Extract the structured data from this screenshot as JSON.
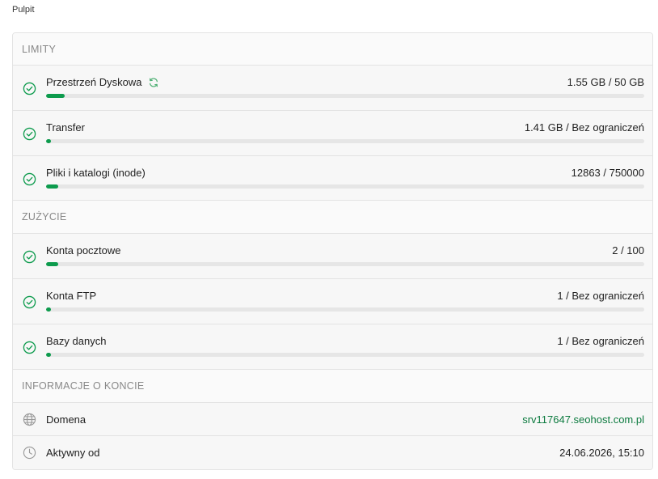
{
  "breadcrumb": "Pulpit",
  "colors": {
    "accent": "#0d9b4d",
    "link": "#0b7a3e",
    "track": "#e6e6e6"
  },
  "limits": {
    "header": "LIMITY",
    "items": [
      {
        "label": "Przestrzeń Dyskowa",
        "value": "1.55 GB / 50 GB",
        "percent": 3.1,
        "icon": "check-circle-icon",
        "has_refresh": true
      },
      {
        "label": "Transfer",
        "value": "1.41 GB / Bez ograniczeń",
        "percent": 0.8,
        "icon": "check-circle-icon"
      },
      {
        "label": "Pliki i katalogi (inode)",
        "value": "12863 / 750000",
        "percent": 2.0,
        "icon": "check-circle-icon"
      }
    ]
  },
  "usage": {
    "header": "ZUŻYCIE",
    "items": [
      {
        "label": "Konta pocztowe",
        "value": "2 / 100",
        "percent": 2.0,
        "icon": "check-circle-icon"
      },
      {
        "label": "Konta FTP",
        "value": "1 / Bez ograniczeń",
        "percent": 0.8,
        "icon": "check-circle-icon"
      },
      {
        "label": "Bazy danych",
        "value": "1 / Bez ograniczeń",
        "percent": 0.8,
        "icon": "check-circle-icon"
      }
    ]
  },
  "account": {
    "header": "INFORMACJE O KONCIE",
    "domain": {
      "label": "Domena",
      "value": "srv117647.seohost.com.pl",
      "icon": "globe-icon"
    },
    "active_since": {
      "label": "Aktywny od",
      "value": "24.06.2026, 15:10",
      "icon": "clock-icon"
    }
  }
}
